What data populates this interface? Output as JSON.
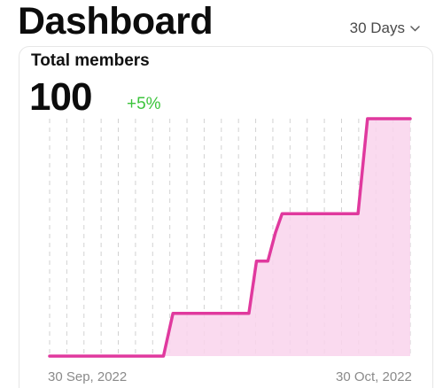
{
  "header": {
    "title": "Dashboard",
    "range_label": "30 Days"
  },
  "card": {
    "title": "Total members",
    "value": "100",
    "delta": "+5%"
  },
  "colors": {
    "line": "#e0399e",
    "fill": "#f9d3ec",
    "grid": "#d2d2d2",
    "delta": "#3cc43c"
  },
  "chart_data": {
    "type": "area",
    "x_tick_labels": [
      "30 Sep, 2022",
      "30 Oct, 2022"
    ],
    "grid": true,
    "y_hidden": true,
    "ylim": [
      0,
      100
    ],
    "series": [
      {
        "x": [
          0,
          10,
          12,
          13,
          20,
          21,
          21.8,
          23,
          23.8,
          24.5,
          32,
          32.5,
          33.5,
          38
        ],
        "y": [
          0,
          0,
          0,
          18,
          18,
          18,
          40,
          40,
          52,
          60,
          60,
          60,
          100,
          100
        ]
      }
    ],
    "xlim": [
      0,
      38
    ]
  }
}
